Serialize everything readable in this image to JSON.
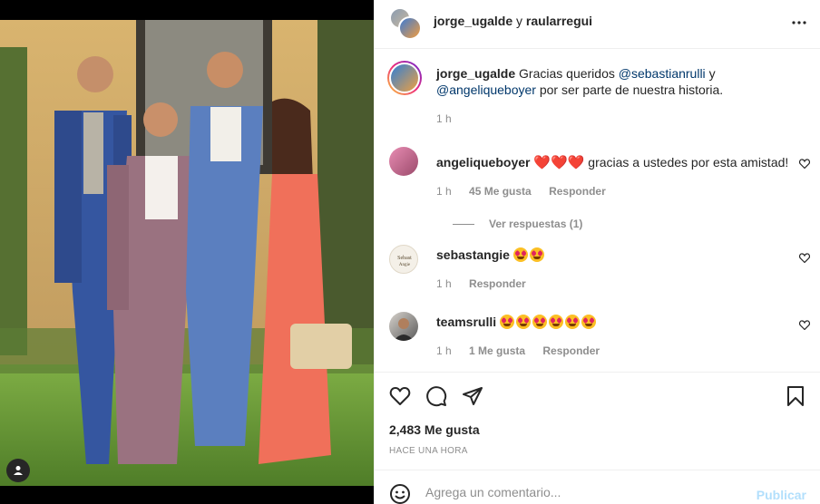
{
  "header": {
    "user1": "jorge_ugalde",
    "conjunction": "y",
    "user2": "raularregui",
    "more_icon": "more-horizontal-icon"
  },
  "caption": {
    "username": "jorge_ugalde",
    "text_before": "Gracias queridos",
    "mention1": "@sebastianrulli",
    "text_middle": "y",
    "mention2": "@angeliqueboyer",
    "text_after": "por ser parte de nuestra historia.",
    "time": "1 h"
  },
  "comments": [
    {
      "username": "angeliqueboyer",
      "text": "gracias a ustedes por esta amistad!",
      "emoji": "❤️❤️❤️",
      "time": "1 h",
      "likes": "45 Me gusta",
      "reply": "Responder",
      "view_replies": "Ver respuestas (1)"
    },
    {
      "username": "sebastangie",
      "emoji": "😍😍",
      "time": "1 h",
      "reply": "Responder"
    },
    {
      "username": "teamsrulli",
      "emoji": "😍😍😍😍😍😍",
      "time": "1 h",
      "likes": "1 Me gusta",
      "reply": "Responder"
    }
  ],
  "actions": {
    "icons": [
      "heart-icon",
      "comment-icon",
      "share-icon",
      "bookmark-icon"
    ],
    "likes": "2,483 Me gusta",
    "posted": "HACE UNA HORA"
  },
  "add_comment": {
    "placeholder": "Agrega un comentario...",
    "publish": "Publicar"
  },
  "colors": {
    "link": "#00376b",
    "muted": "#8e8e8e",
    "publish_disabled": "#b2dffc",
    "heart": "#ed4956"
  }
}
